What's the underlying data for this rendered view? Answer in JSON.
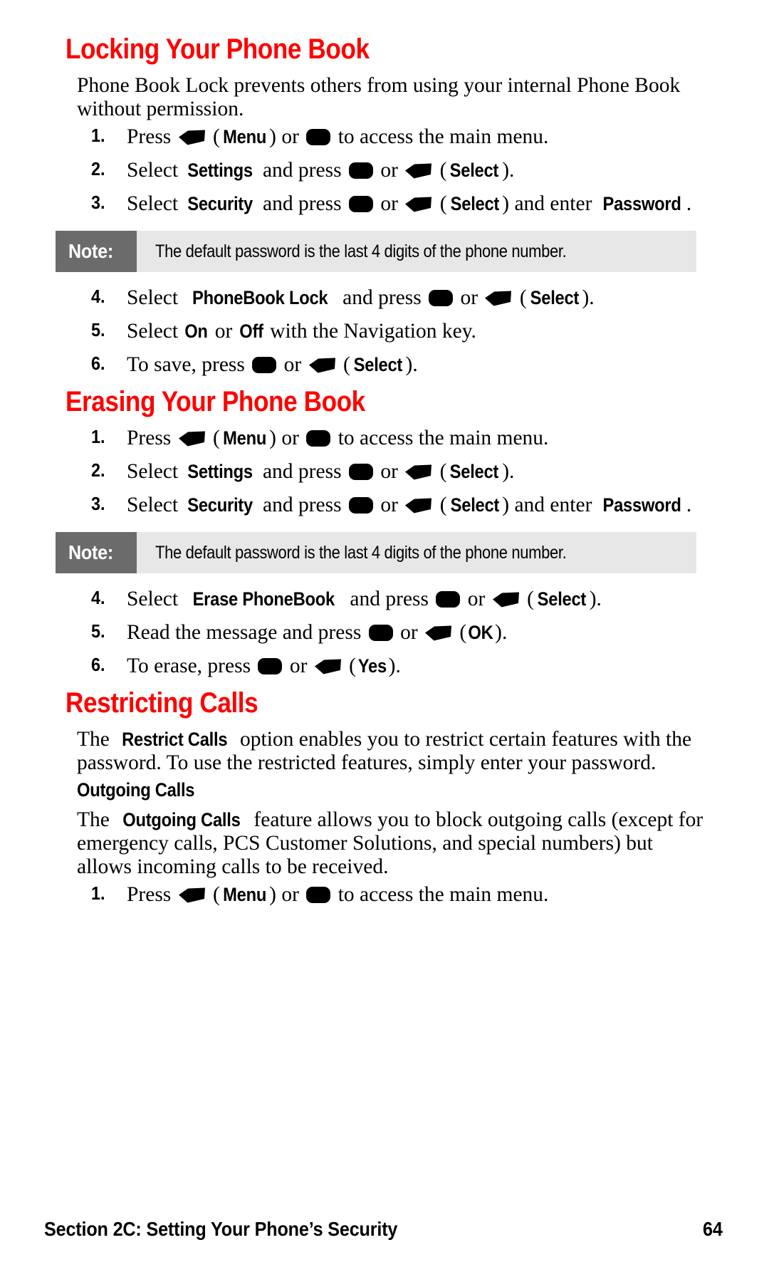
{
  "colors": {
    "heading_red": "#FF0000",
    "note_label_bg": "#6B6B6B",
    "note_body_bg": "#E7E7E7",
    "text": "#000000",
    "page_bg": "#FFFFFF"
  },
  "icons": {
    "softkey": "softkey-arrow-icon",
    "ok_button": "ok-round-button-icon"
  },
  "sections": [
    {
      "id": "locking-your-phone-book",
      "heading": "Locking Your Phone Book",
      "intro": "Phone Book Lock prevents others from using your internal Phone Book without permission.",
      "steps_before_note": [
        {
          "number": "1.",
          "parts": [
            {
              "t": "text",
              "v": "Press "
            },
            {
              "t": "softkey"
            },
            {
              "t": "text",
              "v": " ("
            },
            {
              "t": "ui",
              "v": "Menu"
            },
            {
              "t": "text",
              "v": ") or "
            },
            {
              "t": "ok"
            },
            {
              "t": "text",
              "v": " to access the main menu."
            }
          ]
        },
        {
          "number": "2.",
          "parts": [
            {
              "t": "text",
              "v": "Select "
            },
            {
              "t": "ui",
              "v": "Settings"
            },
            {
              "t": "text",
              "v": " and press "
            },
            {
              "t": "ok"
            },
            {
              "t": "text",
              "v": " or "
            },
            {
              "t": "softkey"
            },
            {
              "t": "text",
              "v": " ("
            },
            {
              "t": "ui",
              "v": "Select"
            },
            {
              "t": "text",
              "v": ")."
            }
          ]
        },
        {
          "number": "3.",
          "parts": [
            {
              "t": "text",
              "v": "Select "
            },
            {
              "t": "ui",
              "v": "Security"
            },
            {
              "t": "text",
              "v": " and press "
            },
            {
              "t": "ok"
            },
            {
              "t": "text",
              "v": " or "
            },
            {
              "t": "softkey"
            },
            {
              "t": "text",
              "v": " ("
            },
            {
              "t": "ui",
              "v": "Select"
            },
            {
              "t": "text",
              "v": ") and enter "
            },
            {
              "t": "ui",
              "v": "Password"
            },
            {
              "t": "text",
              "v": "."
            }
          ]
        }
      ],
      "note": {
        "label": "Note:",
        "text": "The default password is the last 4 digits of the phone number."
      },
      "steps_after_note": [
        {
          "number": "4.",
          "parts": [
            {
              "t": "text",
              "v": "Select "
            },
            {
              "t": "ui",
              "v": "PhoneBook Lock"
            },
            {
              "t": "text",
              "v": " and press "
            },
            {
              "t": "ok"
            },
            {
              "t": "text",
              "v": " or "
            },
            {
              "t": "softkey"
            },
            {
              "t": "text",
              "v": " ("
            },
            {
              "t": "ui",
              "v": "Select"
            },
            {
              "t": "text",
              "v": ")."
            }
          ]
        },
        {
          "number": "5.",
          "parts": [
            {
              "t": "text",
              "v": "Select "
            },
            {
              "t": "ui",
              "v": "On"
            },
            {
              "t": "text",
              "v": " or "
            },
            {
              "t": "ui",
              "v": "Off"
            },
            {
              "t": "text",
              "v": " with the Navigation key."
            }
          ]
        },
        {
          "number": "6.",
          "parts": [
            {
              "t": "text",
              "v": "To save, press "
            },
            {
              "t": "ok"
            },
            {
              "t": "text",
              "v": " or "
            },
            {
              "t": "softkey"
            },
            {
              "t": "text",
              "v": " ("
            },
            {
              "t": "ui",
              "v": "Select"
            },
            {
              "t": "text",
              "v": ")."
            }
          ]
        }
      ]
    },
    {
      "id": "erasing-your-phone-book",
      "heading": "Erasing Your Phone Book",
      "intro": "",
      "steps_before_note": [
        {
          "number": "1.",
          "parts": [
            {
              "t": "text",
              "v": "Press "
            },
            {
              "t": "softkey"
            },
            {
              "t": "text",
              "v": " ("
            },
            {
              "t": "ui",
              "v": "Menu"
            },
            {
              "t": "text",
              "v": ") or "
            },
            {
              "t": "ok"
            },
            {
              "t": "text",
              "v": " to access the main menu."
            }
          ]
        },
        {
          "number": "2.",
          "parts": [
            {
              "t": "text",
              "v": "Select "
            },
            {
              "t": "ui",
              "v": "Settings"
            },
            {
              "t": "text",
              "v": " and press "
            },
            {
              "t": "ok"
            },
            {
              "t": "text",
              "v": " or "
            },
            {
              "t": "softkey"
            },
            {
              "t": "text",
              "v": " ("
            },
            {
              "t": "ui",
              "v": "Select"
            },
            {
              "t": "text",
              "v": ")."
            }
          ]
        },
        {
          "number": "3.",
          "parts": [
            {
              "t": "text",
              "v": "Select "
            },
            {
              "t": "ui",
              "v": "Security"
            },
            {
              "t": "text",
              "v": " and press "
            },
            {
              "t": "ok"
            },
            {
              "t": "text",
              "v": " or "
            },
            {
              "t": "softkey"
            },
            {
              "t": "text",
              "v": " ("
            },
            {
              "t": "ui",
              "v": "Select"
            },
            {
              "t": "text",
              "v": ") and enter "
            },
            {
              "t": "ui",
              "v": "Password"
            },
            {
              "t": "text",
              "v": "."
            }
          ]
        }
      ],
      "note": {
        "label": "Note:",
        "text": "The default password is the last 4 digits of the phone number."
      },
      "steps_after_note": [
        {
          "number": "4.",
          "parts": [
            {
              "t": "text",
              "v": "Select "
            },
            {
              "t": "ui",
              "v": "Erase PhoneBook"
            },
            {
              "t": "text",
              "v": " and press "
            },
            {
              "t": "ok"
            },
            {
              "t": "text",
              "v": " or "
            },
            {
              "t": "softkey"
            },
            {
              "t": "text",
              "v": " ("
            },
            {
              "t": "ui",
              "v": "Select"
            },
            {
              "t": "text",
              "v": ")."
            }
          ]
        },
        {
          "number": "5.",
          "parts": [
            {
              "t": "text",
              "v": "Read the message and press "
            },
            {
              "t": "ok"
            },
            {
              "t": "text",
              "v": " or "
            },
            {
              "t": "softkey"
            },
            {
              "t": "text",
              "v": " ("
            },
            {
              "t": "ui",
              "v": "OK"
            },
            {
              "t": "text",
              "v": ")."
            }
          ]
        },
        {
          "number": "6.",
          "parts": [
            {
              "t": "text",
              "v": "To erase, press "
            },
            {
              "t": "ok"
            },
            {
              "t": "text",
              "v": " or "
            },
            {
              "t": "softkey"
            },
            {
              "t": "text",
              "v": " ("
            },
            {
              "t": "ui",
              "v": "Yes"
            },
            {
              "t": "text",
              "v": ")."
            }
          ]
        }
      ]
    },
    {
      "id": "restricting-calls",
      "heading": "Restricting Calls",
      "intro_parts": [
        {
          "t": "text",
          "v": "The "
        },
        {
          "t": "ui",
          "v": "Restrict Calls"
        },
        {
          "t": "text",
          "v": " option enables you to restrict certain features with the password. To use the restricted features, simply enter your password."
        }
      ],
      "subsection": {
        "heading": "Outgoing Calls",
        "intro_parts": [
          {
            "t": "text",
            "v": "The "
          },
          {
            "t": "ui",
            "v": "Outgoing Calls"
          },
          {
            "t": "text",
            "v": " feature allows you to block outgoing calls (except for emergency calls, PCS Customer Solutions, and special numbers) but allows incoming calls to be received."
          }
        ],
        "steps": [
          {
            "number": "1.",
            "parts": [
              {
                "t": "text",
                "v": "Press "
              },
              {
                "t": "softkey"
              },
              {
                "t": "text",
                "v": " ("
              },
              {
                "t": "ui",
                "v": "Menu"
              },
              {
                "t": "text",
                "v": ") or "
              },
              {
                "t": "ok"
              },
              {
                "t": "text",
                "v": " to access the main menu."
              }
            ]
          }
        ]
      }
    }
  ],
  "footer": {
    "section_label": "Section 2C: Setting Your Phone’s Security",
    "page_number": "64"
  }
}
